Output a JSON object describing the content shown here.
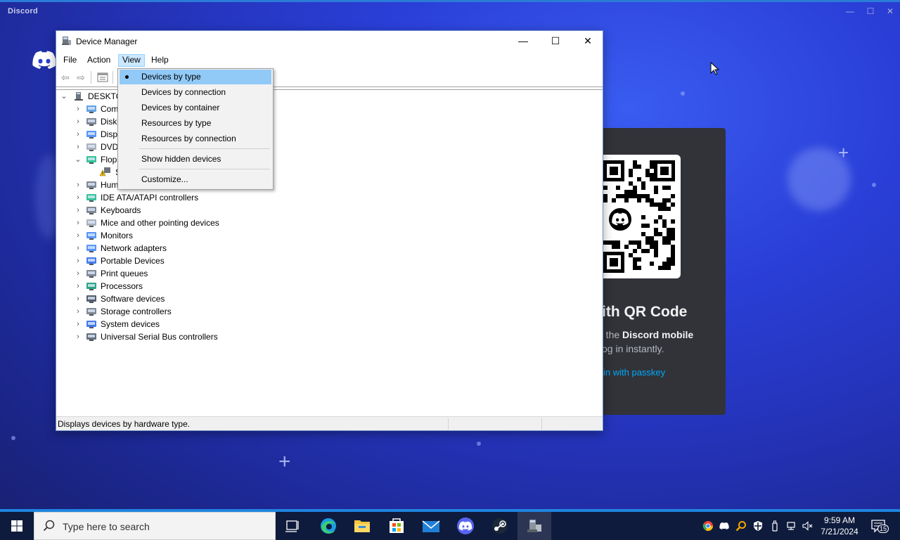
{
  "discord": {
    "title": "Discord",
    "controls": {
      "minimize": "—",
      "maximize": "☐",
      "close": "✕"
    },
    "qr_title": "ith QR Code",
    "qr_sub1_prefix": "n the ",
    "qr_sub1_bold": "Discord mobile",
    "qr_sub2": "og in instantly.",
    "qr_link": "in with passkey"
  },
  "device_manager": {
    "title": "Device Manager",
    "controls": {
      "minimize": "—",
      "maximize": "☐",
      "close": "✕"
    },
    "menu": {
      "file": "File",
      "action": "Action",
      "view": "View",
      "help": "Help"
    },
    "tree": {
      "root": "DESKTO",
      "items": [
        {
          "label": "Com",
          "expander": "›"
        },
        {
          "label": "Disk",
          "expander": "›"
        },
        {
          "label": "Disp",
          "expander": "›"
        },
        {
          "label": "DVD",
          "expander": "›"
        },
        {
          "label": "Flop",
          "expander": "⌄"
        },
        {
          "label": "S",
          "expander": ""
        },
        {
          "label": "Hum",
          "expander": "›"
        },
        {
          "label": "IDE ATA/ATAPI controllers",
          "expander": "›"
        },
        {
          "label": "Keyboards",
          "expander": "›"
        },
        {
          "label": "Mice and other pointing devices",
          "expander": "›"
        },
        {
          "label": "Monitors",
          "expander": "›"
        },
        {
          "label": "Network adapters",
          "expander": "›"
        },
        {
          "label": "Portable Devices",
          "expander": "›"
        },
        {
          "label": "Print queues",
          "expander": "›"
        },
        {
          "label": "Processors",
          "expander": "›"
        },
        {
          "label": "Software devices",
          "expander": "›"
        },
        {
          "label": "Storage controllers",
          "expander": "›"
        },
        {
          "label": "System devices",
          "expander": "›"
        },
        {
          "label": "Universal Serial Bus controllers",
          "expander": "›"
        }
      ]
    },
    "status": "Displays devices by hardware type."
  },
  "view_menu": {
    "items": [
      {
        "label": "Devices by type",
        "checked": true
      },
      {
        "label": "Devices by connection",
        "checked": false
      },
      {
        "label": "Devices by container",
        "checked": false
      },
      {
        "label": "Resources by type",
        "checked": false
      },
      {
        "label": "Resources by connection",
        "checked": false
      },
      {
        "label": "Show hidden devices",
        "checked": false
      },
      {
        "label": "Customize...",
        "checked": false
      }
    ]
  },
  "taskbar": {
    "search_placeholder": "Type here to search",
    "time": "9:59 AM",
    "date": "7/21/2024",
    "notification_count": "15",
    "apps": [
      "task-view",
      "edge",
      "file-explorer",
      "microsoft-store",
      "mail",
      "discord",
      "steam",
      "device-manager"
    ]
  },
  "colors": {
    "menu_highlight": "#91c9f7",
    "discord_link": "#00a8fc",
    "taskbar_bg": "#0f1b3d"
  }
}
